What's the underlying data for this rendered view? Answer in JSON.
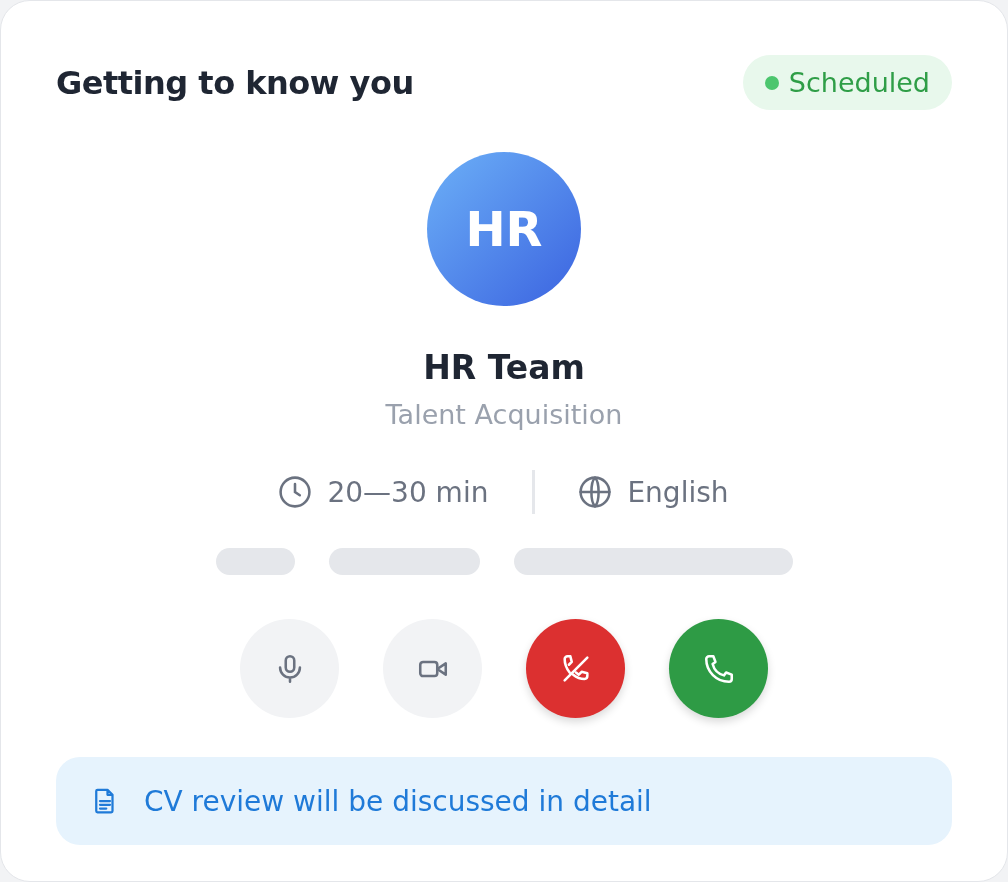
{
  "card": {
    "title": "Getting to know you",
    "status": {
      "label": "Scheduled",
      "color": "#4cc66e"
    },
    "avatar": {
      "initials": "HR"
    },
    "name": "HR Team",
    "role": "Talent Acquisition",
    "meta": [
      {
        "kind": "duration",
        "text": "20—30 min"
      },
      {
        "kind": "language",
        "text": "English"
      }
    ],
    "controls": [
      {
        "kind": "microphone"
      },
      {
        "kind": "camera"
      },
      {
        "kind": "decline"
      },
      {
        "kind": "accept"
      }
    ],
    "note": {
      "text": "CV review will be discussed in detail"
    }
  }
}
